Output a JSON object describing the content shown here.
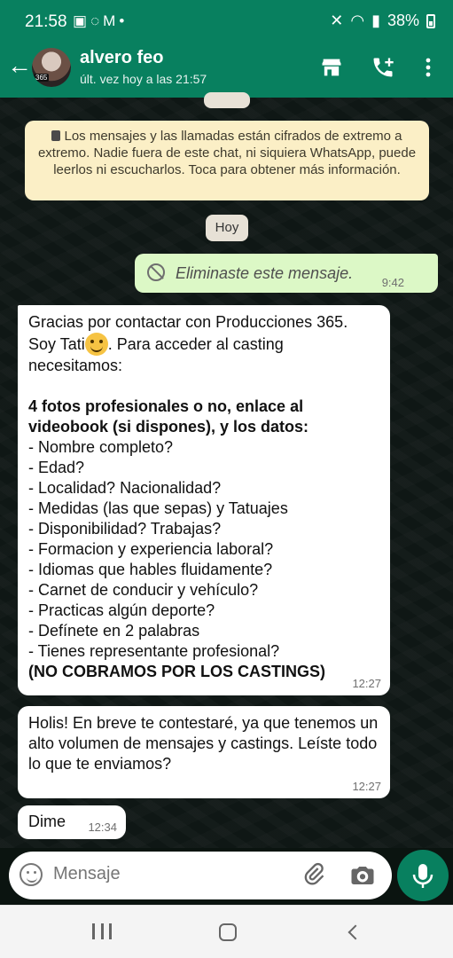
{
  "status_bar": {
    "time": "21:58",
    "battery": "38%"
  },
  "header": {
    "contact_name": "alvero feo",
    "last_seen": "últ. vez hoy a las 21:57",
    "avatar_tag": "365"
  },
  "chat": {
    "encryption_notice": "Los mensajes y las llamadas están cifrados de extremo a extremo. Nadie fuera de este chat, ni siquiera WhatsApp, puede leerlos ni escucharlos. Toca para obtener más información.",
    "day_label": "Hoy",
    "sent_message": {
      "text": "Eliminaste este mensaje.",
      "time": "9:42"
    },
    "message1": {
      "intro_part1": "Gracias por contactar con Producciones 365. Soy Tati",
      "intro_part2": ". Para acceder al casting necesitamos:",
      "bold_line1": "4 fotos profesionales o no, enlace al",
      "bold_line2": "videobook (si dispones), y los datos:",
      "items": [
        "- Nombre completo?",
        "- Edad?",
        "- Localidad? Nacionalidad?",
        "- Medidas (las que sepas) y Tatuajes",
        "- Disponibilidad? Trabajas?",
        "- Formacion y experiencia laboral?",
        "- Idiomas que hables fluidamente?",
        "- Carnet de conducir y vehículo?",
        "- Practicas algún deporte?",
        "- Defínete en 2 palabras",
        "- Tienes representante profesional?"
      ],
      "final_bold": "(NO COBRAMOS POR LOS CASTINGS)",
      "time": "12:27"
    },
    "message2": {
      "text": "Holis! En breve te contestaré, ya que tenemos un alto volumen de mensajes y castings. Leíste todo lo que te enviamos?",
      "time": "12:27"
    },
    "message3": {
      "text": "Dime",
      "time": "12:34"
    }
  },
  "input": {
    "placeholder": "Mensaje"
  },
  "colors": {
    "header_green": "#08805f",
    "sent_bubble": "#dcf8c6",
    "encryption_banner": "#fbefc6"
  }
}
